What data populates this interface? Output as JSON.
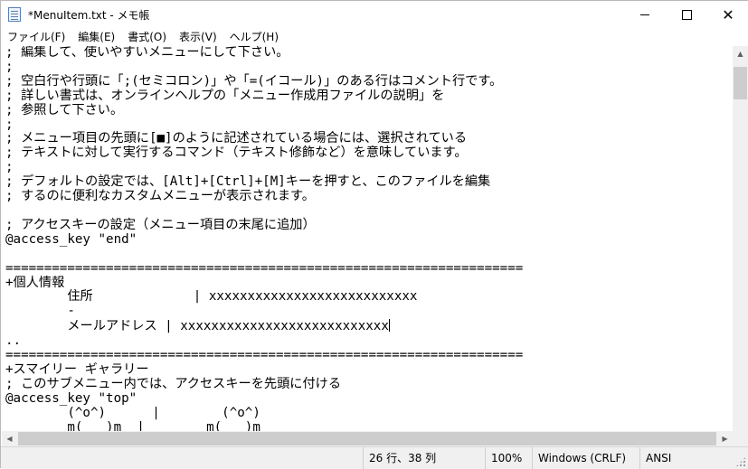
{
  "window": {
    "title": "*MenuItem.txt - メモ帳"
  },
  "titlebar": {
    "minimize_icon": "minimize-icon",
    "maximize_icon": "maximize-icon",
    "close_glyph": "✕"
  },
  "menubar": {
    "items": [
      {
        "label": "ファイル(F)"
      },
      {
        "label": "編集(E)"
      },
      {
        "label": "書式(O)"
      },
      {
        "label": "表示(V)"
      },
      {
        "label": "ヘルプ(H)"
      }
    ]
  },
  "editor": {
    "lines": [
      "; 編集して、使いやすいメニューにして下さい。",
      ";",
      "; 空白行や行頭に「;(セミコロン)」や「=(イコール)」のある行はコメント行です。",
      "; 詳しい書式は、オンラインヘルプの「メニュー作成用ファイルの説明」を",
      "; 参照して下さい。",
      ";",
      "; メニュー項目の先頭に[■]のように記述されている場合には、選択されている",
      "; テキストに対して実行するコマンド（テキスト修飾など）を意味しています。",
      ";",
      "; デフォルトの設定では、[Alt]+[Ctrl]+[M]キーを押すと、このファイルを編集",
      "; するのに便利なカスタムメニューが表示されます。",
      "",
      "; アクセスキーの設定（メニュー項目の末尾に追加）",
      "@access_key \"end\"",
      "",
      "===================================================================",
      "+個人情報",
      "        住所             | xxxxxxxxxxxxxxxxxxxxxxxxxxx",
      "        -",
      "        メールアドレス | xxxxxxxxxxxxxxxxxxxxxxxxxxx",
      "..",
      "===================================================================",
      "+スマイリー ギャラリー",
      "; このサブメニュー内では、アクセスキーを先頭に付ける",
      "@access_key \"top\"",
      "        (^o^)      |        (^o^)",
      "        m(_ _)m  |        m(_ _)m"
    ],
    "caret_line": 19
  },
  "statusbar": {
    "position": "26 行、38 列",
    "zoom": "100%",
    "line_ending": "Windows (CRLF)",
    "encoding": "ANSI"
  }
}
